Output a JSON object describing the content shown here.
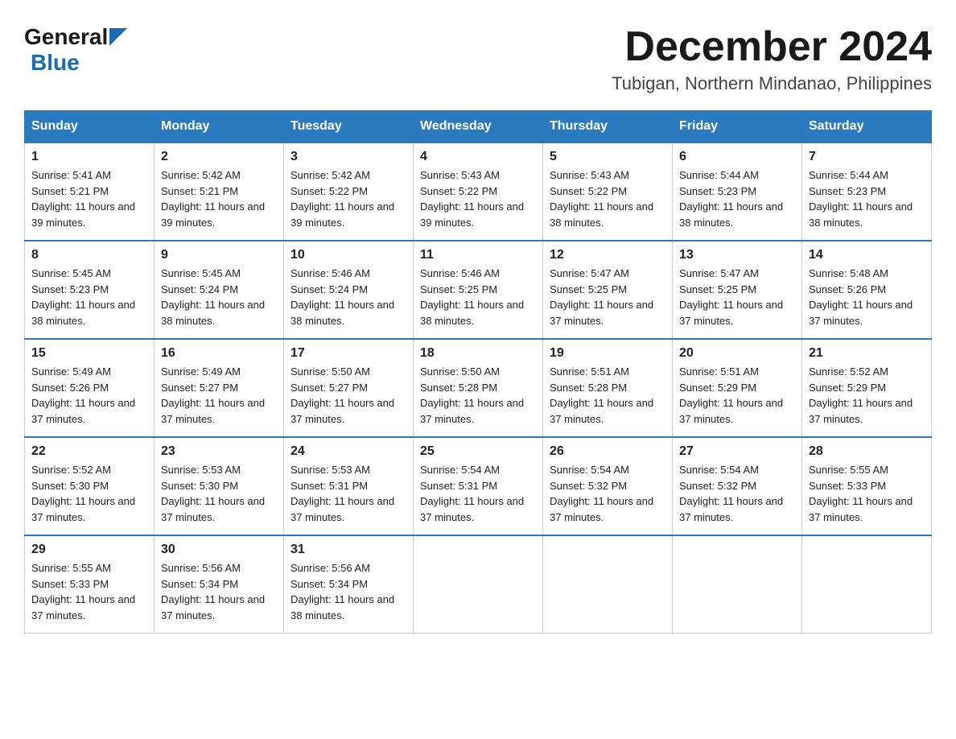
{
  "header": {
    "logo_general": "General",
    "logo_blue": "Blue",
    "month_title": "December 2024",
    "location": "Tubigan, Northern Mindanao, Philippines"
  },
  "calendar": {
    "days_of_week": [
      "Sunday",
      "Monday",
      "Tuesday",
      "Wednesday",
      "Thursday",
      "Friday",
      "Saturday"
    ],
    "weeks": [
      [
        {
          "day": "1",
          "sunrise": "5:41 AM",
          "sunset": "5:21 PM",
          "daylight": "11 hours and 39 minutes."
        },
        {
          "day": "2",
          "sunrise": "5:42 AM",
          "sunset": "5:21 PM",
          "daylight": "11 hours and 39 minutes."
        },
        {
          "day": "3",
          "sunrise": "5:42 AM",
          "sunset": "5:22 PM",
          "daylight": "11 hours and 39 minutes."
        },
        {
          "day": "4",
          "sunrise": "5:43 AM",
          "sunset": "5:22 PM",
          "daylight": "11 hours and 39 minutes."
        },
        {
          "day": "5",
          "sunrise": "5:43 AM",
          "sunset": "5:22 PM",
          "daylight": "11 hours and 38 minutes."
        },
        {
          "day": "6",
          "sunrise": "5:44 AM",
          "sunset": "5:23 PM",
          "daylight": "11 hours and 38 minutes."
        },
        {
          "day": "7",
          "sunrise": "5:44 AM",
          "sunset": "5:23 PM",
          "daylight": "11 hours and 38 minutes."
        }
      ],
      [
        {
          "day": "8",
          "sunrise": "5:45 AM",
          "sunset": "5:23 PM",
          "daylight": "11 hours and 38 minutes."
        },
        {
          "day": "9",
          "sunrise": "5:45 AM",
          "sunset": "5:24 PM",
          "daylight": "11 hours and 38 minutes."
        },
        {
          "day": "10",
          "sunrise": "5:46 AM",
          "sunset": "5:24 PM",
          "daylight": "11 hours and 38 minutes."
        },
        {
          "day": "11",
          "sunrise": "5:46 AM",
          "sunset": "5:25 PM",
          "daylight": "11 hours and 38 minutes."
        },
        {
          "day": "12",
          "sunrise": "5:47 AM",
          "sunset": "5:25 PM",
          "daylight": "11 hours and 37 minutes."
        },
        {
          "day": "13",
          "sunrise": "5:47 AM",
          "sunset": "5:25 PM",
          "daylight": "11 hours and 37 minutes."
        },
        {
          "day": "14",
          "sunrise": "5:48 AM",
          "sunset": "5:26 PM",
          "daylight": "11 hours and 37 minutes."
        }
      ],
      [
        {
          "day": "15",
          "sunrise": "5:49 AM",
          "sunset": "5:26 PM",
          "daylight": "11 hours and 37 minutes."
        },
        {
          "day": "16",
          "sunrise": "5:49 AM",
          "sunset": "5:27 PM",
          "daylight": "11 hours and 37 minutes."
        },
        {
          "day": "17",
          "sunrise": "5:50 AM",
          "sunset": "5:27 PM",
          "daylight": "11 hours and 37 minutes."
        },
        {
          "day": "18",
          "sunrise": "5:50 AM",
          "sunset": "5:28 PM",
          "daylight": "11 hours and 37 minutes."
        },
        {
          "day": "19",
          "sunrise": "5:51 AM",
          "sunset": "5:28 PM",
          "daylight": "11 hours and 37 minutes."
        },
        {
          "day": "20",
          "sunrise": "5:51 AM",
          "sunset": "5:29 PM",
          "daylight": "11 hours and 37 minutes."
        },
        {
          "day": "21",
          "sunrise": "5:52 AM",
          "sunset": "5:29 PM",
          "daylight": "11 hours and 37 minutes."
        }
      ],
      [
        {
          "day": "22",
          "sunrise": "5:52 AM",
          "sunset": "5:30 PM",
          "daylight": "11 hours and 37 minutes."
        },
        {
          "day": "23",
          "sunrise": "5:53 AM",
          "sunset": "5:30 PM",
          "daylight": "11 hours and 37 minutes."
        },
        {
          "day": "24",
          "sunrise": "5:53 AM",
          "sunset": "5:31 PM",
          "daylight": "11 hours and 37 minutes."
        },
        {
          "day": "25",
          "sunrise": "5:54 AM",
          "sunset": "5:31 PM",
          "daylight": "11 hours and 37 minutes."
        },
        {
          "day": "26",
          "sunrise": "5:54 AM",
          "sunset": "5:32 PM",
          "daylight": "11 hours and 37 minutes."
        },
        {
          "day": "27",
          "sunrise": "5:54 AM",
          "sunset": "5:32 PM",
          "daylight": "11 hours and 37 minutes."
        },
        {
          "day": "28",
          "sunrise": "5:55 AM",
          "sunset": "5:33 PM",
          "daylight": "11 hours and 37 minutes."
        }
      ],
      [
        {
          "day": "29",
          "sunrise": "5:55 AM",
          "sunset": "5:33 PM",
          "daylight": "11 hours and 37 minutes."
        },
        {
          "day": "30",
          "sunrise": "5:56 AM",
          "sunset": "5:34 PM",
          "daylight": "11 hours and 37 minutes."
        },
        {
          "day": "31",
          "sunrise": "5:56 AM",
          "sunset": "5:34 PM",
          "daylight": "11 hours and 38 minutes."
        },
        null,
        null,
        null,
        null
      ]
    ]
  }
}
